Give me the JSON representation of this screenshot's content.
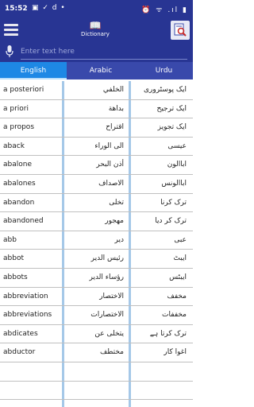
{
  "status_bar": {
    "time": "15:52",
    "left_icons": "▣ ✓ d •",
    "right_icons": "⏰ ᯤ .ıl ▮"
  },
  "app_bar": {
    "title": "Dictionary"
  },
  "search": {
    "placeholder": "Enter text here"
  },
  "tabs": [
    {
      "label": "English",
      "active": true
    },
    {
      "label": "Arabic",
      "active": false
    },
    {
      "label": "Urdu",
      "active": false
    }
  ],
  "rows": [
    {
      "en": "a posteriori",
      "ar": "الخلفي",
      "ur": "ایک پوسٹروری"
    },
    {
      "en": "a priori",
      "ar": "بداهة",
      "ur": "ایک ترجیح"
    },
    {
      "en": "a propos",
      "ar": "اقتراح",
      "ur": "ایک تجویز"
    },
    {
      "en": "aback",
      "ar": "الى الوراء",
      "ur": "عیسی"
    },
    {
      "en": "abalone",
      "ar": "أذن البحر",
      "ur": "اباالون"
    },
    {
      "en": "abalones",
      "ar": "الاصداف",
      "ur": "اباالونس"
    },
    {
      "en": "abandon",
      "ar": "تخلى",
      "ur": "ترک کرنا"
    },
    {
      "en": "abandoned",
      "ar": "مهجور",
      "ur": "ترک کر دیا"
    },
    {
      "en": "abb",
      "ar": "دير",
      "ur": "عبی"
    },
    {
      "en": "abbot",
      "ar": "رئيس الدير",
      "ur": "ایبٹ"
    },
    {
      "en": "abbots",
      "ar": "رؤساء الدير",
      "ur": "ایبٹس"
    },
    {
      "en": "abbreviation",
      "ar": "الاختصار",
      "ur": "مخفف"
    },
    {
      "en": "abbreviations",
      "ar": "الاختصارات",
      "ur": "مخففات"
    },
    {
      "en": "abdicates",
      "ar": "يتخلى عن",
      "ur": "ترک کرتا ہے"
    },
    {
      "en": "abductor",
      "ar": "مختطف",
      "ur": "اغوا کار"
    },
    {
      "en": "",
      "ar": "",
      "ur": ""
    },
    {
      "en": "",
      "ar": "",
      "ur": ""
    }
  ],
  "colors": {
    "app_bar": "#283593",
    "tab_active": "#1e88e5",
    "divider": "#5b9bd5"
  }
}
